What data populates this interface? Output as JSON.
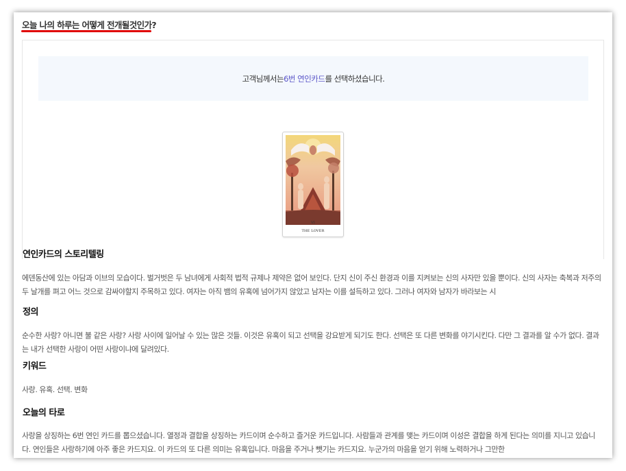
{
  "page": {
    "title": "오늘 나의 하루는 어떻게 전개될것인가?",
    "accent_color": "#e00000"
  },
  "notice": {
    "prefix": "고객님께서는 ",
    "highlight": "6번 연인카드",
    "suffix": "를 선택하셨습니다.",
    "highlight_color": "#5a55c8"
  },
  "card": {
    "numeral": "VI",
    "name": "THE LOVER",
    "icon": "lovers-tarot-card-image"
  },
  "sections": [
    {
      "heading": "연인카드의 스토리텔링",
      "text": "에덴동산에 있는 아담과 이브의 모습이다. 벌거벗은 두 남녀에게 사회적 법적 규제나 제약은 없어 보인다. 단지 신이 주신 환경과 이를 지켜보는 신의 사자만 있을 뿐이다. 신의 사자는 축복과 저주의 두 날개를 펴고 어느 것으로 감싸야할지 주목하고 있다. 여자는 아직 뱀의 유혹에 넘어가지 않았고 남자는 이를 설득하고 있다. 그러나 여자와 남자가 바라보는 시"
    },
    {
      "heading": "정의",
      "text": "순수한 사랑? 아니면 불 같은 사랑? 사랑 사이에 일어날 수 있는 많은 것들. 이것은 유혹이 되고 선택을 강요받게 되기도 한다. 선택은 또 다른 변화를 야기시킨다. 다만 그 결과를 알 수가 없다. 결과는 내가 선택한 사랑이 어떤 사랑이냐에 달려있다."
    },
    {
      "heading": "키워드",
      "text": "사랑. 유혹. 선택. 변화"
    },
    {
      "heading": "오늘의 타로",
      "text": "사랑을 상징하는 6번 연인 카드를 뽑으셨습니다. 열정과 결합을 상징하는 카드이며 순수하고 즐거운 카드입니다. 사람들과 관계를 맺는 카드이며 이성은 결합을 하게 된다는 의미를 지니고 있습니다. 연인들은 사랑하기에 아주 좋은 카드지요. 이 카드의 또 다른 의미는 유혹입니다. 마음을 주거나 뺏기는 카드지요. 누군가의 마음을 얻기 위해 노력하거나 그만한"
    }
  ]
}
